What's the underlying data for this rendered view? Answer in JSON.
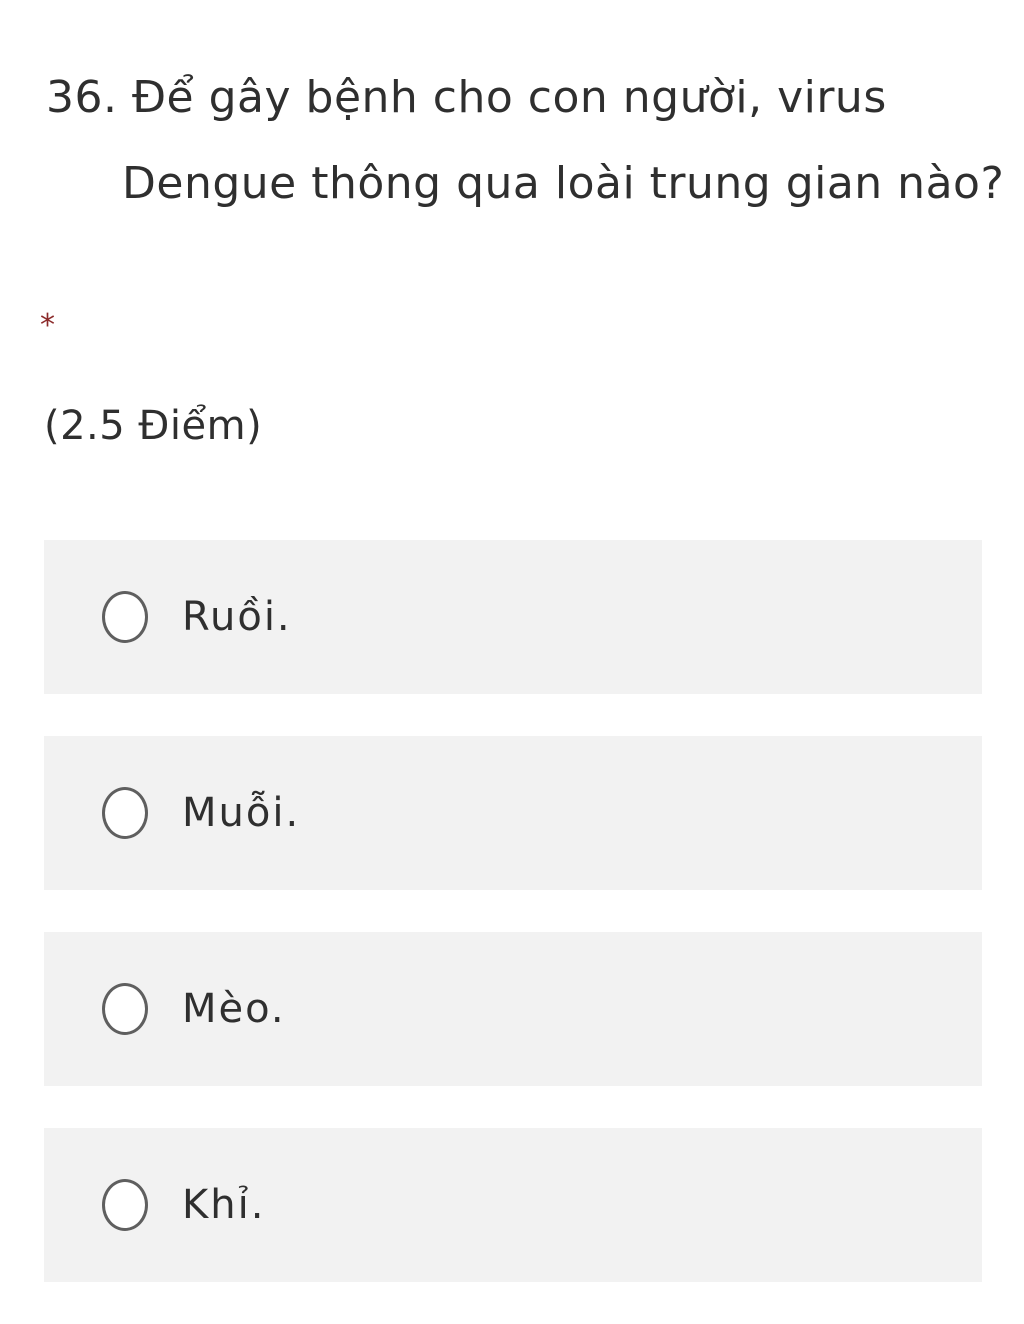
{
  "question": {
    "line1": "36. Để gây bệnh cho con người, virus",
    "line2": "Dengue thông qua loài trung gian nào?"
  },
  "required_marker": "*",
  "points_label": "(2.5 Điểm)",
  "options": [
    {
      "label": "Ruồi.",
      "selected": false
    },
    {
      "label": "Muỗi.",
      "selected": false
    },
    {
      "label": "Mèo.",
      "selected": false
    },
    {
      "label": "Khỉ.",
      "selected": false
    }
  ]
}
